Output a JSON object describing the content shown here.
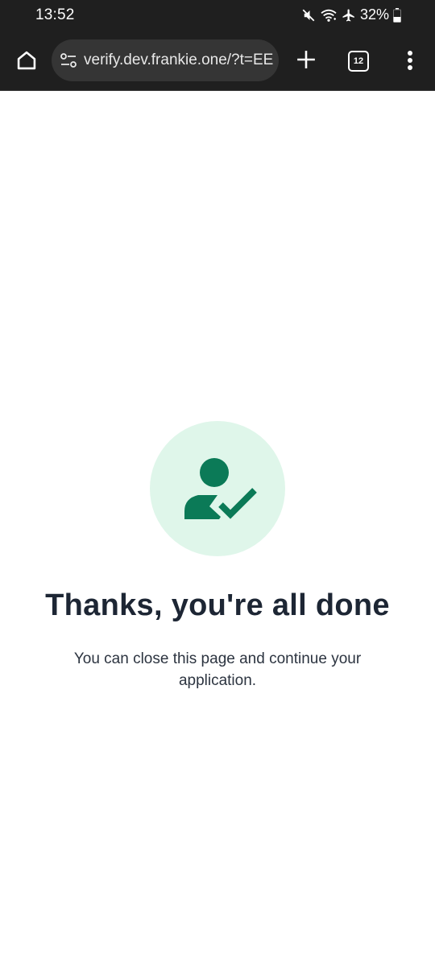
{
  "status_bar": {
    "time": "13:52",
    "battery": "32%",
    "icons": [
      "mute-icon",
      "wifi-icon",
      "airplane-icon",
      "battery-icon"
    ]
  },
  "browser": {
    "url": "verify.dev.frankie.one/?t=EE",
    "tab_count": "12",
    "icons": [
      "home-icon",
      "site-settings-icon",
      "plus-icon",
      "tab-switcher-icon",
      "more-vert-icon"
    ]
  },
  "page": {
    "title": "Thanks, you're all done",
    "message": "You can close this page and continue your application.",
    "icon": "user-check-icon"
  },
  "colors": {
    "accent": "#0b7a57",
    "accent_bg": "#dff6ea",
    "title": "#1d2634",
    "chrome_bg": "#1f1f1f",
    "omnibox_bg": "#353535"
  }
}
